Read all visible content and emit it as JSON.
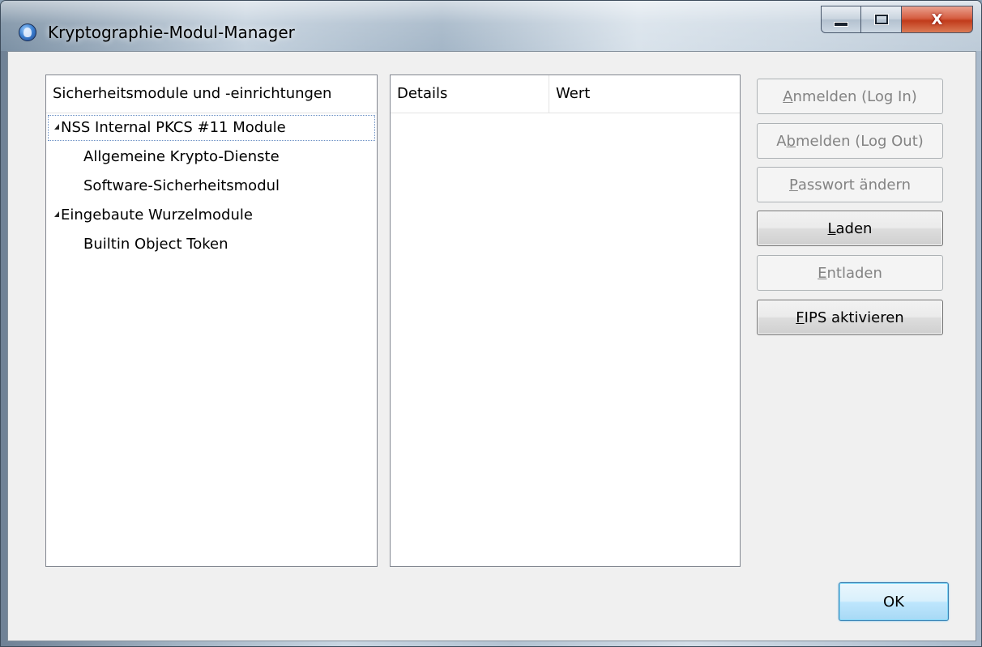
{
  "window": {
    "title": "Kryptographie-Modul-Manager",
    "app_icon": "thunderbird-icon"
  },
  "caption_buttons": {
    "minimize_icon": "minimize-icon",
    "maximize_icon": "maximize-icon",
    "close_label": "X"
  },
  "tree": {
    "header": "Sicherheitsmodule und -einrichtungen",
    "items": [
      {
        "label": "NSS Internal PKCS #11 Module",
        "level": 0,
        "expanded": true,
        "selected": true
      },
      {
        "label": "Allgemeine Krypto-Dienste",
        "level": 1
      },
      {
        "label": "Software-Sicherheitsmodul",
        "level": 1
      },
      {
        "label": "Eingebaute Wurzelmodule",
        "level": 0,
        "expanded": true
      },
      {
        "label": "Builtin Object Token",
        "level": 1
      }
    ]
  },
  "details": {
    "columns": [
      "Details",
      "Wert"
    ]
  },
  "buttons": {
    "login": {
      "accel": "A",
      "rest": "nmelden (Log In)",
      "enabled": false
    },
    "logout": {
      "pre": "A",
      "accel": "b",
      "rest": "melden (Log Out)",
      "enabled": false
    },
    "password": {
      "accel": "P",
      "rest": "asswort ändern",
      "enabled": false
    },
    "load": {
      "accel": "L",
      "rest": "aden",
      "enabled": true
    },
    "unload": {
      "accel": "E",
      "rest": "ntladen",
      "enabled": false
    },
    "fips": {
      "accel": "F",
      "rest": "IPS aktivieren",
      "enabled": true
    },
    "ok": "OK"
  },
  "colors": {
    "disabled_text": "#838383",
    "selection_outline": "#6a8fc4",
    "close_button": "#c13b1b"
  }
}
